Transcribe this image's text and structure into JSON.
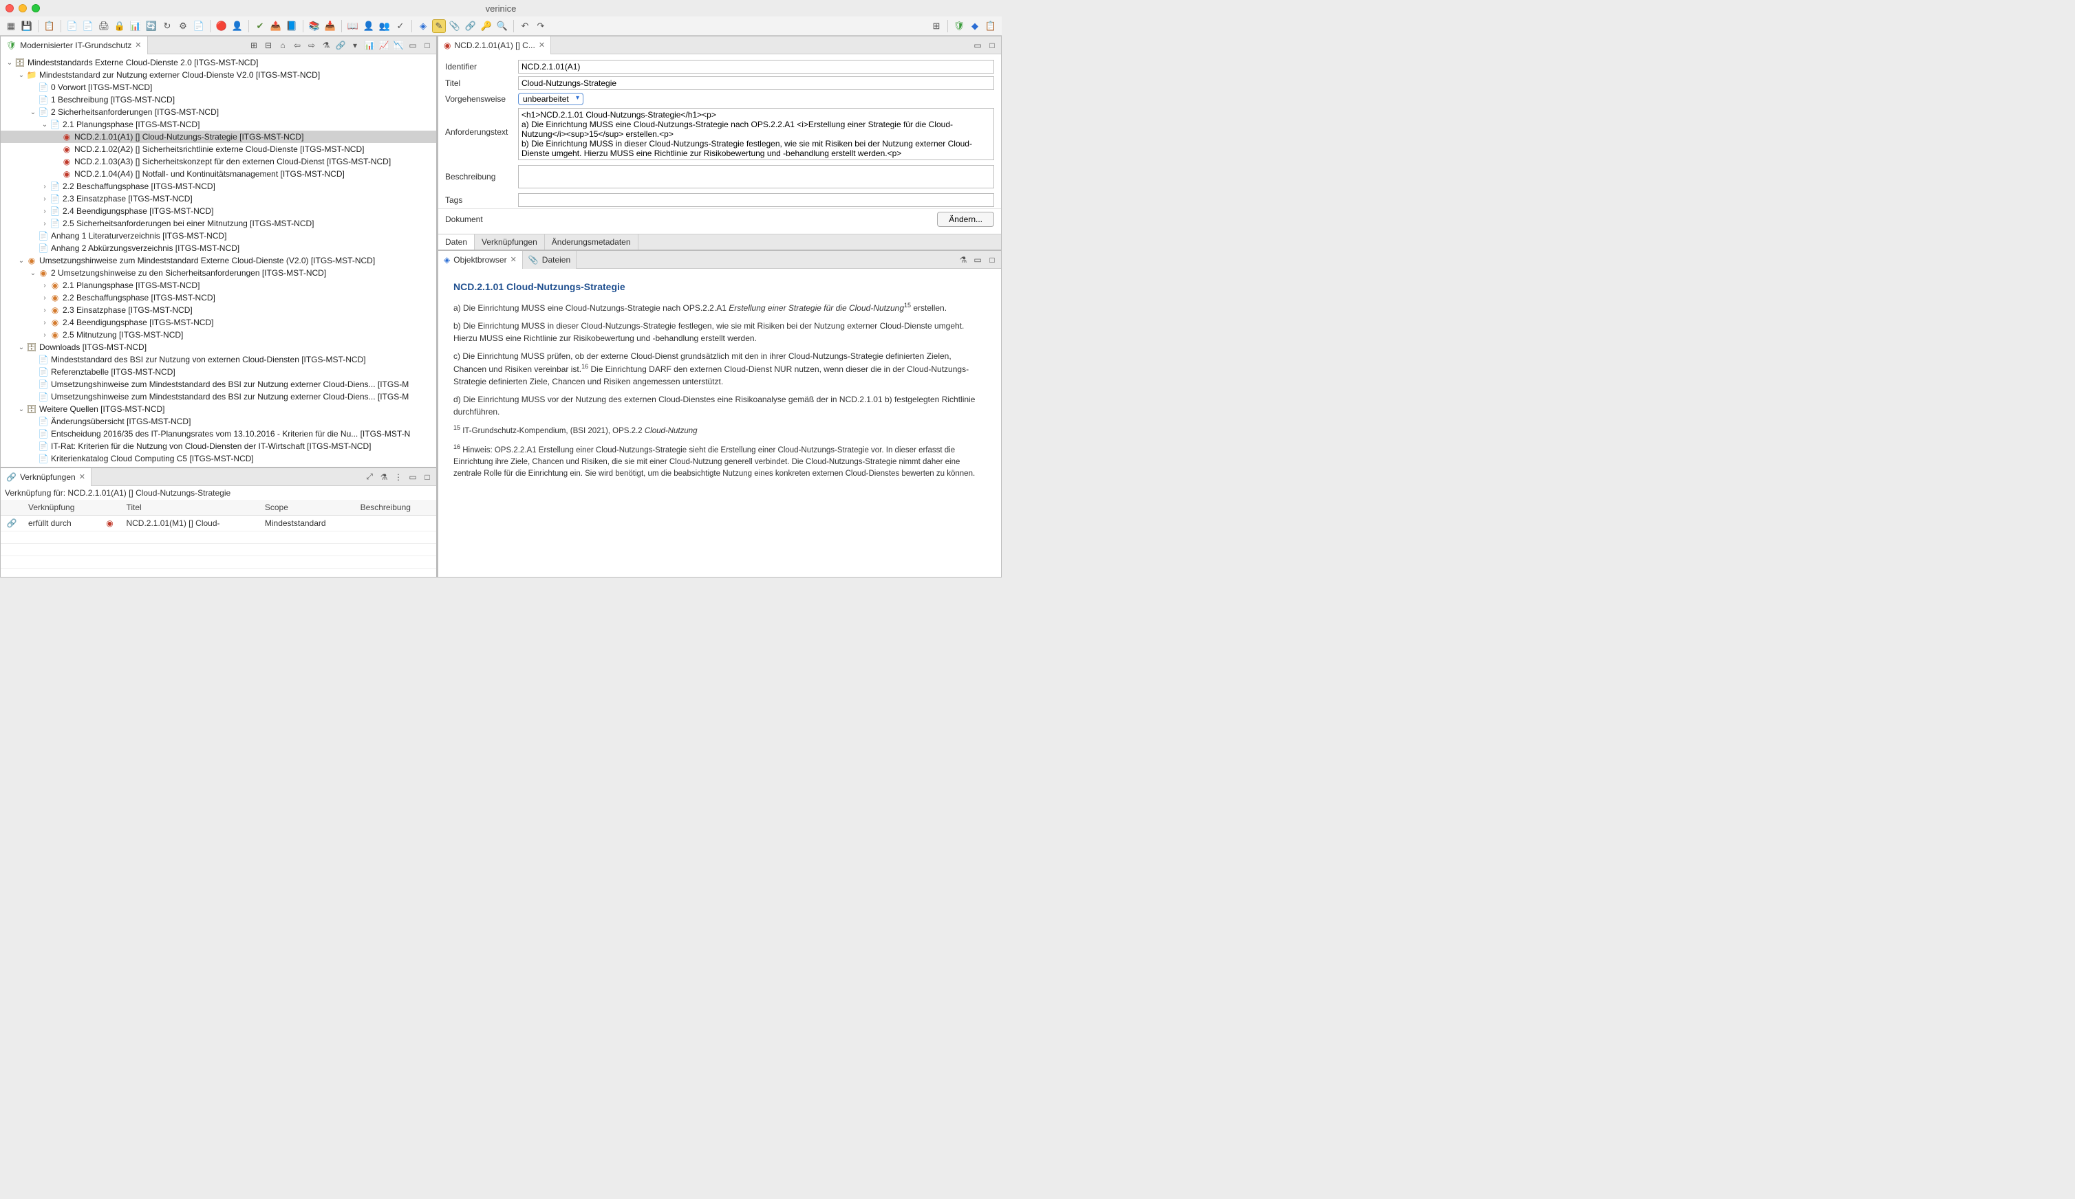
{
  "window": {
    "title": "verinice"
  },
  "views": {
    "grundschutz": {
      "tab": "Modernisierter IT-Grundschutz"
    },
    "links": {
      "tab": "Verknüpfungen",
      "subtitle": "Verknüpfung für: NCD.2.1.01(A1) [] Cloud-Nutzungs-Strategie",
      "cols": {
        "link": "Verknüpfung",
        "title": "Titel",
        "scope": "Scope",
        "desc": "Beschreibung"
      },
      "rows": [
        {
          "link": "erfüllt durch",
          "title": "NCD.2.1.01(M1) [] Cloud-",
          "scope": "Mindeststandard",
          "desc": ""
        }
      ]
    },
    "editor": {
      "tab": "NCD.2.1.01(A1) [] C...",
      "fields": {
        "identifier": {
          "label": "Identifier",
          "value": "NCD.2.1.01(A1)"
        },
        "titel": {
          "label": "Titel",
          "value": "Cloud-Nutzungs-Strategie"
        },
        "vorgehensweise": {
          "label": "Vorgehensweise",
          "value": "unbearbeitet"
        },
        "anforderungstext": {
          "label": "Anforderungstext",
          "value": "<h1>NCD.2.1.01 Cloud-Nutzungs-Strategie</h1><p>\na) Die Einrichtung MUSS eine Cloud-Nutzungs-Strategie nach OPS.2.2.A1 <i>Erstellung einer Strategie für die Cloud-Nutzung</i><sup>15</sup> erstellen.<p>\nb) Die Einrichtung MUSS in dieser Cloud-Nutzungs-Strategie festlegen, wie sie mit Risiken bei der Nutzung externer Cloud-Dienste umgeht. Hierzu MUSS eine Richtlinie zur Risikobewertung und -behandlung erstellt werden.<p>"
        },
        "beschreibung": {
          "label": "Beschreibung",
          "value": ""
        },
        "tags": {
          "label": "Tags",
          "value": ""
        },
        "dokument": {
          "label": "Dokument",
          "button": "Ändern..."
        }
      },
      "subtabs": {
        "daten": "Daten",
        "verkn": "Verknüpfungen",
        "meta": "Änderungsmetadaten"
      }
    },
    "browser": {
      "tab": "Objektbrowser",
      "tab2": "Dateien"
    }
  },
  "browser_content": {
    "heading": "NCD.2.1.01 Cloud-Nutzungs-Strategie",
    "p_a_prefix": "a) Die Einrichtung MUSS eine Cloud-Nutzungs-Strategie nach OPS.2.2.A1 ",
    "p_a_em": "Erstellung einer Strategie für die Cloud-Nutzung",
    "p_a_suffix": " erstellen.",
    "p_b": "b) Die Einrichtung MUSS in dieser Cloud-Nutzungs-Strategie festlegen, wie sie mit Risiken bei der Nutzung externer Cloud-Dienste umgeht. Hierzu MUSS eine Richtlinie zur Risikobewertung und -behandlung erstellt werden.",
    "p_c_1": "c) Die Einrichtung MUSS prüfen, ob der externe Cloud-Dienst grundsätzlich mit den in ihrer Cloud-Nutzungs-Strategie definierten Zielen, Chancen und Risiken vereinbar ist.",
    "p_c_2": " Die Einrichtung DARF den externen Cloud-Dienst NUR nutzen, wenn dieser die in der Cloud-Nutzungs-Strategie definierten Ziele, Chancen und Risiken angemessen unterstützt.",
    "p_d": "d) Die Einrichtung MUSS vor der Nutzung des externen Cloud-Dienstes eine Risikoanalyse gemäß der in NCD.2.1.01 b) festgelegten Richtlinie durchführen.",
    "fn15_prefix": " IT-Grundschutz-Kompendium, (BSI 2021), OPS.2.2 ",
    "fn15_em": "Cloud-Nutzung",
    "fn16": " Hinweis: OPS.2.2.A1 Erstellung einer Cloud-Nutzungs-Strategie sieht die Erstellung einer Cloud-Nutzungs-Strategie vor. In dieser erfasst die Einrichtung ihre Ziele, Chancen und Risiken, die sie mit einer Cloud-Nutzung generell verbindet. Die Cloud-Nutzungs-Strategie nimmt daher eine zentrale Rolle für die Einrichtung ein. Sie wird benötigt, um die beabsichtigte Nutzung eines konkreten externen Cloud-Dienstes bewerten zu können."
  },
  "tree": [
    {
      "d": 0,
      "exp": "open",
      "icon": "db",
      "label": "Mindeststandards Externe Cloud-Dienste 2.0 [ITGS-MST-NCD]"
    },
    {
      "d": 1,
      "exp": "open",
      "icon": "folder",
      "label": "Mindeststandard zur Nutzung externer Cloud-Dienste V2.0 [ITGS-MST-NCD]"
    },
    {
      "d": 2,
      "exp": "none",
      "icon": "doc",
      "label": "0 Vorwort [ITGS-MST-NCD]"
    },
    {
      "d": 2,
      "exp": "none",
      "icon": "doc",
      "label": "1 Beschreibung [ITGS-MST-NCD]"
    },
    {
      "d": 2,
      "exp": "open",
      "icon": "doc",
      "label": "2 Sicherheitsanforderungen [ITGS-MST-NCD]"
    },
    {
      "d": 3,
      "exp": "open",
      "icon": "doc",
      "label": "2.1 Planungsphase [ITGS-MST-NCD]"
    },
    {
      "d": 4,
      "exp": "none",
      "icon": "red",
      "label": "NCD.2.1.01(A1) [] Cloud-Nutzungs-Strategie [ITGS-MST-NCD]",
      "selected": true
    },
    {
      "d": 4,
      "exp": "none",
      "icon": "red",
      "label": "NCD.2.1.02(A2) [] Sicherheitsrichtlinie externe Cloud-Dienste [ITGS-MST-NCD]"
    },
    {
      "d": 4,
      "exp": "none",
      "icon": "red",
      "label": "NCD.2.1.03(A3) [] Sicherheitskonzept für den externen Cloud-Dienst [ITGS-MST-NCD]"
    },
    {
      "d": 4,
      "exp": "none",
      "icon": "red",
      "label": "NCD.2.1.04(A4) [] Notfall- und Kontinuitätsmanagement [ITGS-MST-NCD]"
    },
    {
      "d": 3,
      "exp": "closed",
      "icon": "doc",
      "label": "2.2 Beschaffungsphase [ITGS-MST-NCD]"
    },
    {
      "d": 3,
      "exp": "closed",
      "icon": "doc",
      "label": "2.3 Einsatzphase [ITGS-MST-NCD]"
    },
    {
      "d": 3,
      "exp": "closed",
      "icon": "doc",
      "label": "2.4 Beendigungsphase [ITGS-MST-NCD]"
    },
    {
      "d": 3,
      "exp": "closed",
      "icon": "doc",
      "label": "2.5 Sicherheitsanforderungen bei einer Mitnutzung [ITGS-MST-NCD]"
    },
    {
      "d": 2,
      "exp": "none",
      "icon": "doc",
      "label": "Anhang 1 Literaturverzeichnis [ITGS-MST-NCD]"
    },
    {
      "d": 2,
      "exp": "none",
      "icon": "doc",
      "label": "Anhang 2 Abkürzungsverzeichnis [ITGS-MST-NCD]"
    },
    {
      "d": 1,
      "exp": "open",
      "icon": "orange",
      "label": "Umsetzungshinweise zum Mindeststandard Externe Cloud-Dienste (V2.0) [ITGS-MST-NCD]"
    },
    {
      "d": 2,
      "exp": "open",
      "icon": "orange",
      "label": "2 Umsetzungshinweise zu den Sicherheitsanforderungen [ITGS-MST-NCD]"
    },
    {
      "d": 3,
      "exp": "closed",
      "icon": "orange",
      "label": "2.1 Planungsphase [ITGS-MST-NCD]"
    },
    {
      "d": 3,
      "exp": "closed",
      "icon": "orange",
      "label": "2.2 Beschaffungsphase [ITGS-MST-NCD]"
    },
    {
      "d": 3,
      "exp": "closed",
      "icon": "orange",
      "label": "2.3 Einsatzphase [ITGS-MST-NCD]"
    },
    {
      "d": 3,
      "exp": "closed",
      "icon": "orange",
      "label": "2.4 Beendigungsphase [ITGS-MST-NCD]"
    },
    {
      "d": 3,
      "exp": "closed",
      "icon": "orange",
      "label": "2.5 Mitnutzung [ITGS-MST-NCD]"
    },
    {
      "d": 1,
      "exp": "open",
      "icon": "db",
      "label": "Downloads [ITGS-MST-NCD]"
    },
    {
      "d": 2,
      "exp": "none",
      "icon": "doc2",
      "label": "Mindeststandard des BSI zur Nutzung von externen Cloud-Diensten [ITGS-MST-NCD]"
    },
    {
      "d": 2,
      "exp": "none",
      "icon": "doc2",
      "label": "Referenztabelle [ITGS-MST-NCD]"
    },
    {
      "d": 2,
      "exp": "none",
      "icon": "doc2",
      "label": "Umsetzungshinweise zum Mindeststandard des BSI zur Nutzung externer Cloud-Diens... [ITGS-M"
    },
    {
      "d": 2,
      "exp": "none",
      "icon": "doc2",
      "label": "Umsetzungshinweise zum Mindeststandard des BSI zur Nutzung externer Cloud-Diens... [ITGS-M"
    },
    {
      "d": 1,
      "exp": "open",
      "icon": "db",
      "label": "Weitere Quellen [ITGS-MST-NCD]"
    },
    {
      "d": 2,
      "exp": "none",
      "icon": "doc2",
      "label": "Änderungsübersicht [ITGS-MST-NCD]"
    },
    {
      "d": 2,
      "exp": "none",
      "icon": "doc2",
      "label": "Entscheidung 2016/35 des IT-Planungsrates vom 13.10.2016 - Kriterien für die Nu... [ITGS-MST-N"
    },
    {
      "d": 2,
      "exp": "none",
      "icon": "doc2",
      "label": "IT-Rat: Kriterien für die Nutzung von Cloud-Diensten der IT-Wirtschaft [ITGS-MST-NCD]"
    },
    {
      "d": 2,
      "exp": "none",
      "icon": "doc2",
      "label": "Kriterienkatalog Cloud Computing C5 [ITGS-MST-NCD]"
    }
  ]
}
